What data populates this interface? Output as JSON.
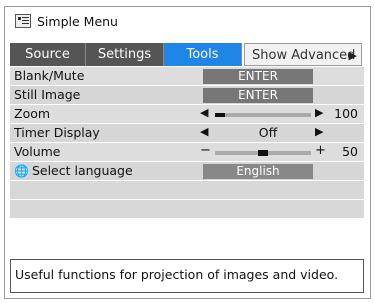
{
  "window": {
    "title": "Simple Menu"
  },
  "tabs": [
    {
      "label": "Source",
      "active": false
    },
    {
      "label": "Settings",
      "active": false
    },
    {
      "label": "Tools",
      "active": true
    },
    {
      "label": "Show Advanced",
      "active": false
    }
  ],
  "tab_arrow": "▶",
  "rows": {
    "blank_mute": {
      "label": "Blank/Mute",
      "button": "ENTER"
    },
    "still_image": {
      "label": "Still Image",
      "button": "ENTER"
    },
    "zoom": {
      "label": "Zoom",
      "value": "100",
      "level": 0.1
    },
    "timer_display": {
      "label": "Timer Display",
      "value": "Off"
    },
    "volume": {
      "label": "Volume",
      "value": "50",
      "minus": "−",
      "plus": "+",
      "level": 0.5
    },
    "language": {
      "label": "Select language",
      "value": "English",
      "icon": "globe-language-icon"
    }
  },
  "arrows": {
    "left": "◀",
    "right": "▶"
  },
  "help_text": "Useful functions for projection of images and video.",
  "colors": {
    "active_tab": "#1f86e8",
    "tab_bg": "#555555",
    "row_bg": "#dddddd",
    "button_bg": "#777777"
  }
}
